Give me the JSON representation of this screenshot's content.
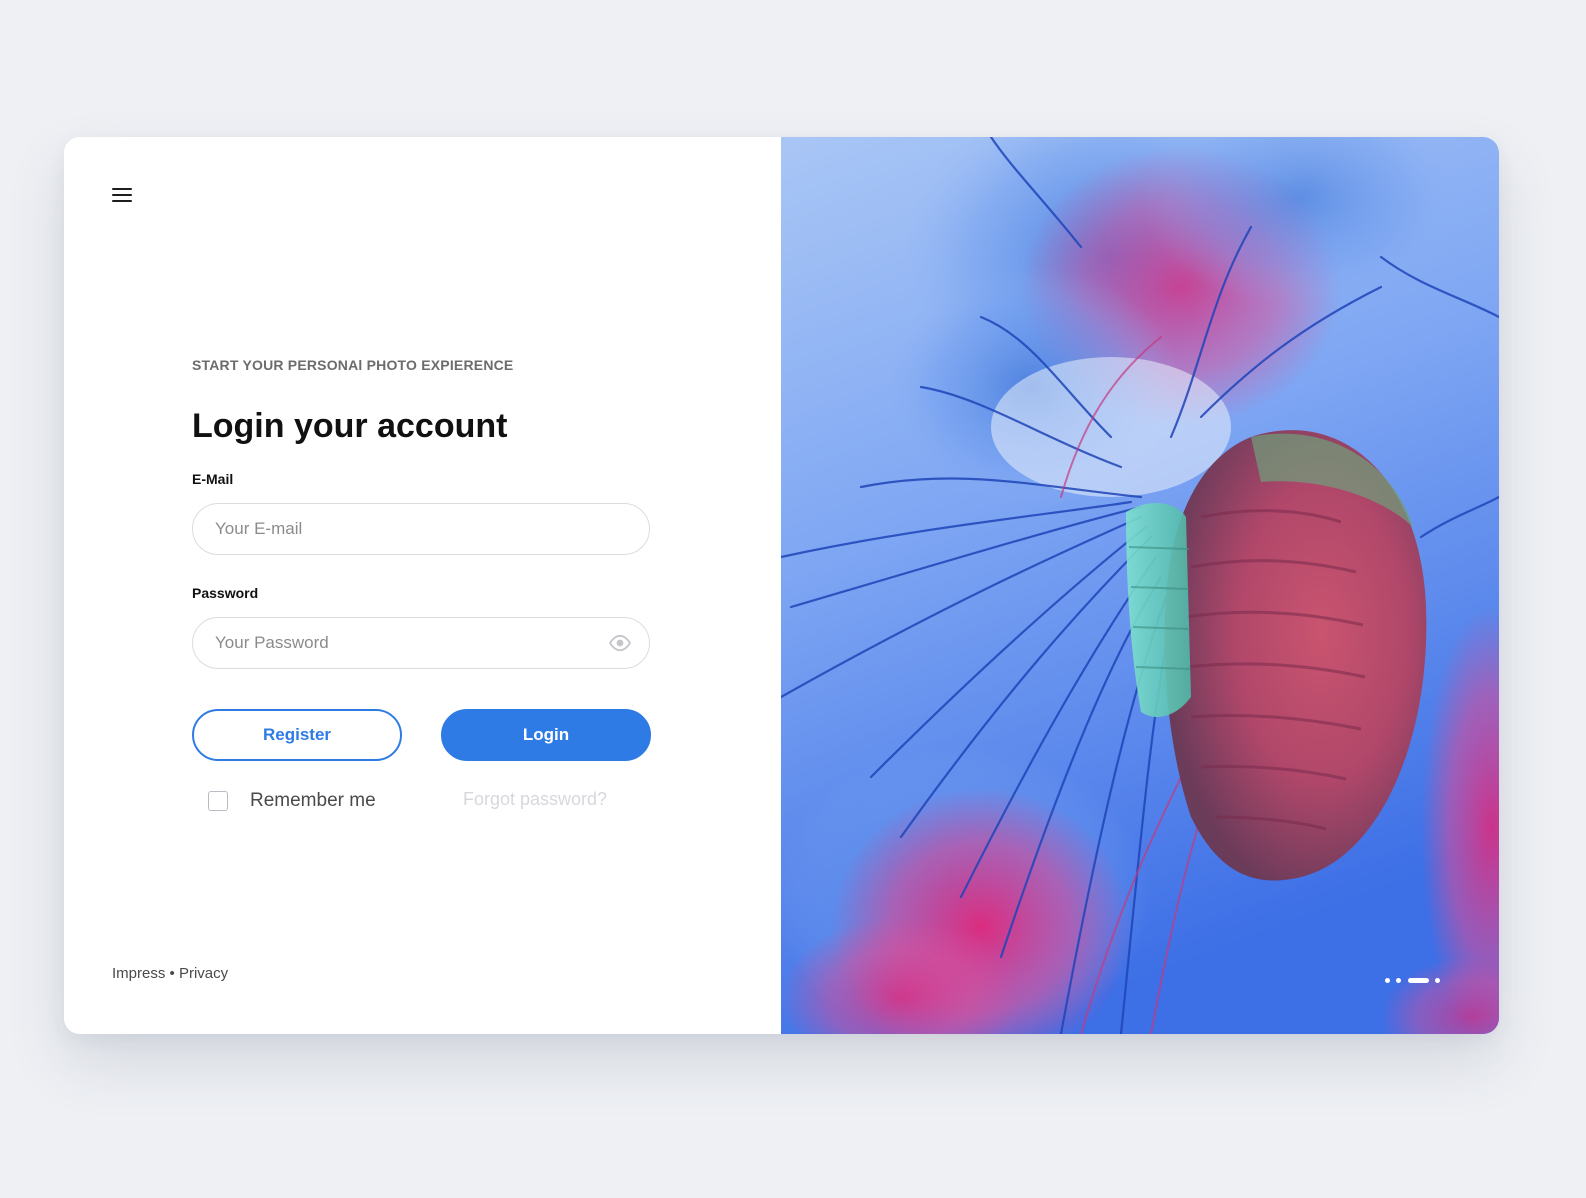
{
  "menu": {
    "icon": "hamburger-menu-icon"
  },
  "form": {
    "eyebrow": "START YOUR PERSONAl PHOTO EXPIERENCE",
    "title": "Login your account",
    "email": {
      "label": "E-Mail",
      "placeholder": "Your E-mail",
      "value": ""
    },
    "password": {
      "label": "Password",
      "placeholder": "Your Password",
      "value": "",
      "toggle_icon": "eye-icon"
    },
    "register_label": "Register",
    "login_label": "Login",
    "remember_label": "Remember me",
    "remember_checked": false,
    "forgot_label": "Forgot password?"
  },
  "footer": {
    "impress": "Impress",
    "separator": "•",
    "privacy": "Privacy"
  },
  "hero": {
    "subject": "jellyfish-photo",
    "carousel": {
      "count": 4,
      "active": 2
    }
  },
  "colors": {
    "accent": "#2f7be5",
    "background": "#eef0f4",
    "hero_blue": "#4b7ff0",
    "hero_pink": "#e0307a"
  }
}
